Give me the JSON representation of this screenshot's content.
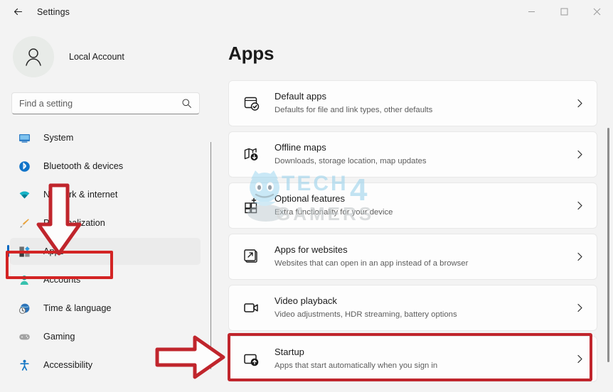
{
  "window": {
    "title": "Settings",
    "back_icon": "back-arrow-icon",
    "controls": [
      {
        "name": "minimize-button",
        "glyph": "minimize-icon"
      },
      {
        "name": "maximize-button",
        "glyph": "maximize-icon"
      },
      {
        "name": "close-button",
        "glyph": "close-icon"
      }
    ]
  },
  "sidebar": {
    "account": {
      "name": "Local Account",
      "avatar_icon": "user-avatar-icon"
    },
    "search": {
      "placeholder": "Find a setting",
      "value": "",
      "icon": "search-icon"
    },
    "items": [
      {
        "label": "System",
        "icon": "monitor-icon",
        "active": false
      },
      {
        "label": "Bluetooth & devices",
        "icon": "bluetooth-icon",
        "active": false
      },
      {
        "label": "Network & internet",
        "icon": "wifi-icon",
        "active": false
      },
      {
        "label": "Personalization",
        "icon": "paintbrush-icon",
        "active": false
      },
      {
        "label": "Apps",
        "icon": "apps-grid-icon",
        "active": true
      },
      {
        "label": "Accounts",
        "icon": "person-icon",
        "active": false
      },
      {
        "label": "Time & language",
        "icon": "clock-globe-icon",
        "active": false
      },
      {
        "label": "Gaming",
        "icon": "game-controller-icon",
        "active": false
      },
      {
        "label": "Accessibility",
        "icon": "accessibility-person-icon",
        "active": false
      }
    ]
  },
  "main": {
    "title": "Apps",
    "cards": [
      {
        "title": "Default apps",
        "subtitle": "Defaults for file and link types, other defaults",
        "icon": "default-apps-icon",
        "chevron": "chevron-right-icon",
        "highlighted": false
      },
      {
        "title": "Offline maps",
        "subtitle": "Downloads, storage location, map updates",
        "icon": "offline-maps-icon",
        "chevron": "chevron-right-icon",
        "highlighted": false
      },
      {
        "title": "Optional features",
        "subtitle": "Extra functionality for your device",
        "icon": "optional-features-icon",
        "chevron": "chevron-right-icon",
        "highlighted": false
      },
      {
        "title": "Apps for websites",
        "subtitle": "Websites that can open in an app instead of a browser",
        "icon": "apps-for-websites-icon",
        "chevron": "chevron-right-icon",
        "highlighted": false
      },
      {
        "title": "Video playback",
        "subtitle": "Video adjustments, HDR streaming, battery options",
        "icon": "video-playback-icon",
        "chevron": "chevron-right-icon",
        "highlighted": false
      },
      {
        "title": "Startup",
        "subtitle": "Apps that start automatically when you sign in",
        "icon": "startup-icon",
        "chevron": "chevron-right-icon",
        "highlighted": true
      }
    ]
  },
  "annotations": {
    "color": "#c0252c",
    "apps_box": "highlight-box-apps",
    "startup_box": "highlight-box-startup",
    "arrow_down": "red-arrow-down",
    "arrow_right": "red-arrow-right"
  },
  "watermark": {
    "line1": "TECH",
    "line2": "4",
    "line3": "GAMERS",
    "color": "#9fd4ec"
  },
  "colors": {
    "accent": "#0067c0",
    "window_bg": "#f3f3f3",
    "card_bg": "#fdfdfd",
    "annotation_red": "#c0252c"
  }
}
